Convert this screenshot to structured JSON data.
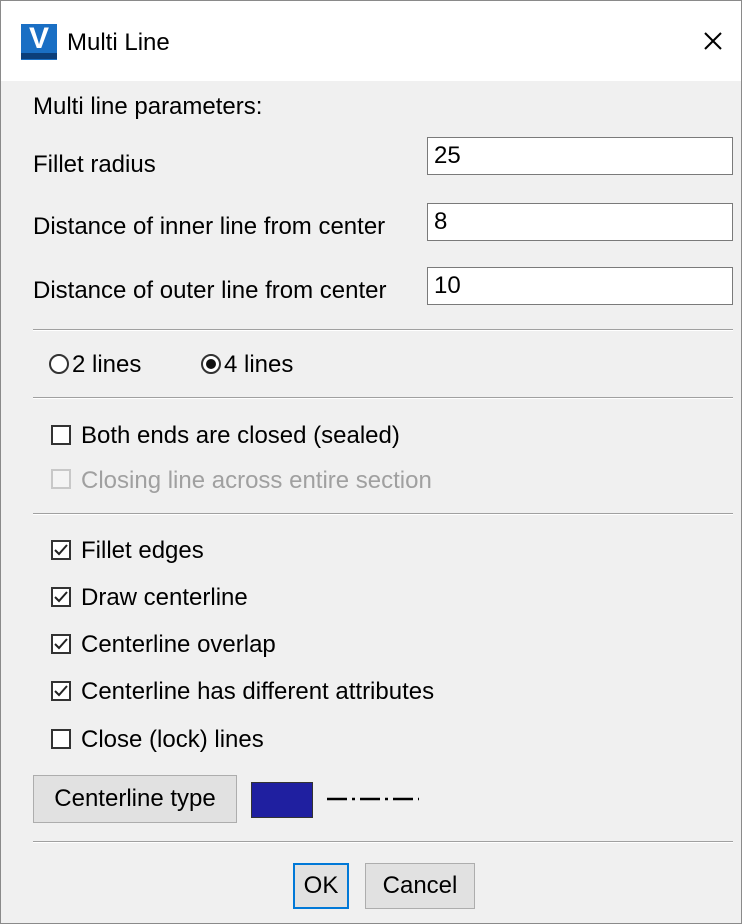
{
  "window": {
    "title": "Multi Line",
    "app_icon": "vectorcad-app-icon",
    "close_icon": "close-icon"
  },
  "params": {
    "heading": "Multi line parameters:",
    "fillet_radius": {
      "label": "Fillet radius",
      "value": "25"
    },
    "inner_distance": {
      "label": "Distance of inner line from center",
      "value": "8"
    },
    "outer_distance": {
      "label": "Distance of outer line from center",
      "value": "10"
    }
  },
  "lines_mode": {
    "options": [
      {
        "label": "2 lines",
        "checked": false
      },
      {
        "label": "4 lines",
        "checked": true
      }
    ]
  },
  "closing": {
    "both_ends_closed": {
      "label": "Both ends are closed (sealed)",
      "checked": false,
      "enabled": true
    },
    "closing_line": {
      "label": "Closing line across entire section",
      "checked": false,
      "enabled": false
    }
  },
  "options": {
    "fillet_edges": {
      "label": "Fillet edges",
      "checked": true
    },
    "draw_centerline": {
      "label": "Draw centerline",
      "checked": true
    },
    "centerline_overlap": {
      "label": "Centerline overlap",
      "checked": true
    },
    "centerline_attributes": {
      "label": "Centerline has different attributes",
      "checked": true
    },
    "close_lock_lines": {
      "label": "Close (lock) lines",
      "checked": false
    }
  },
  "centerline": {
    "type_button": "Centerline type",
    "color": "#1f1fa0",
    "linetype_icon": "dash-dot-linetype-icon"
  },
  "footer": {
    "ok": "OK",
    "cancel": "Cancel"
  }
}
